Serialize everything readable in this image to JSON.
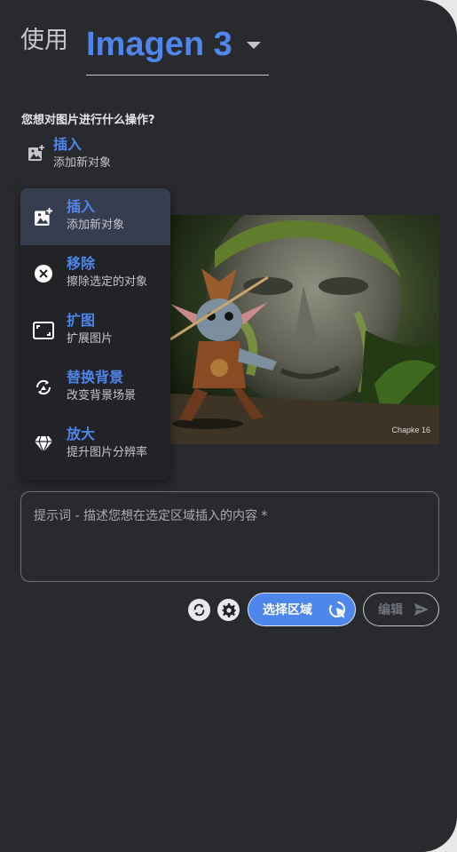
{
  "header": {
    "use_label": "使用",
    "model": "Imagen 3"
  },
  "question": "您想对图片进行什么操作?",
  "current_operation": {
    "title": "插入",
    "description": "添加新对象",
    "icon": "image-add-icon"
  },
  "menu": {
    "items": [
      {
        "title": "插入",
        "description": "添加新对象",
        "icon": "image-add-icon",
        "active": true
      },
      {
        "title": "移除",
        "description": "擦除选定的对象",
        "icon": "remove-circle-icon",
        "active": false
      },
      {
        "title": "扩图",
        "description": "扩展图片",
        "icon": "expand-frame-icon",
        "active": false
      },
      {
        "title": "替换背景",
        "description": "改变背景场景",
        "icon": "replace-background-icon",
        "active": false
      },
      {
        "title": "放大",
        "description": "提升图片分辨率",
        "icon": "diamond-icon",
        "active": false
      }
    ]
  },
  "image": {
    "watermark": "Chapke 16"
  },
  "prompt": {
    "placeholder": "提示词 - 描述您想在选定区域插入的内容 *",
    "value": ""
  },
  "toolbar": {
    "select_area_label": "选择区域",
    "edit_label": "编辑"
  },
  "colors": {
    "accent": "#4f86ec",
    "panel": "#292a2e",
    "menu": "#222327",
    "menu_active": "#363d4f"
  }
}
